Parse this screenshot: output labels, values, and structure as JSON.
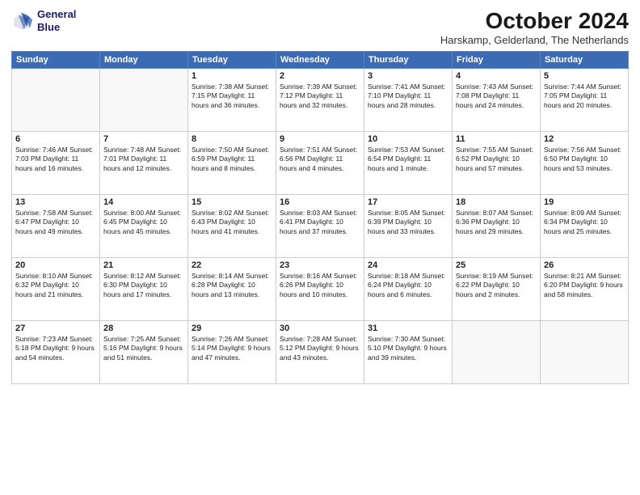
{
  "logo": {
    "line1": "General",
    "line2": "Blue"
  },
  "title": "October 2024",
  "subtitle": "Harskamp, Gelderland, The Netherlands",
  "days": [
    "Sunday",
    "Monday",
    "Tuesday",
    "Wednesday",
    "Thursday",
    "Friday",
    "Saturday"
  ],
  "weeks": [
    [
      {
        "num": "",
        "text": ""
      },
      {
        "num": "",
        "text": ""
      },
      {
        "num": "1",
        "text": "Sunrise: 7:38 AM\nSunset: 7:15 PM\nDaylight: 11 hours and 36 minutes."
      },
      {
        "num": "2",
        "text": "Sunrise: 7:39 AM\nSunset: 7:12 PM\nDaylight: 11 hours and 32 minutes."
      },
      {
        "num": "3",
        "text": "Sunrise: 7:41 AM\nSunset: 7:10 PM\nDaylight: 11 hours and 28 minutes."
      },
      {
        "num": "4",
        "text": "Sunrise: 7:43 AM\nSunset: 7:08 PM\nDaylight: 11 hours and 24 minutes."
      },
      {
        "num": "5",
        "text": "Sunrise: 7:44 AM\nSunset: 7:05 PM\nDaylight: 11 hours and 20 minutes."
      }
    ],
    [
      {
        "num": "6",
        "text": "Sunrise: 7:46 AM\nSunset: 7:03 PM\nDaylight: 11 hours and 16 minutes."
      },
      {
        "num": "7",
        "text": "Sunrise: 7:48 AM\nSunset: 7:01 PM\nDaylight: 11 hours and 12 minutes."
      },
      {
        "num": "8",
        "text": "Sunrise: 7:50 AM\nSunset: 6:59 PM\nDaylight: 11 hours and 8 minutes."
      },
      {
        "num": "9",
        "text": "Sunrise: 7:51 AM\nSunset: 6:56 PM\nDaylight: 11 hours and 4 minutes."
      },
      {
        "num": "10",
        "text": "Sunrise: 7:53 AM\nSunset: 6:54 PM\nDaylight: 11 hours and 1 minute."
      },
      {
        "num": "11",
        "text": "Sunrise: 7:55 AM\nSunset: 6:52 PM\nDaylight: 10 hours and 57 minutes."
      },
      {
        "num": "12",
        "text": "Sunrise: 7:56 AM\nSunset: 6:50 PM\nDaylight: 10 hours and 53 minutes."
      }
    ],
    [
      {
        "num": "13",
        "text": "Sunrise: 7:58 AM\nSunset: 6:47 PM\nDaylight: 10 hours and 49 minutes."
      },
      {
        "num": "14",
        "text": "Sunrise: 8:00 AM\nSunset: 6:45 PM\nDaylight: 10 hours and 45 minutes."
      },
      {
        "num": "15",
        "text": "Sunrise: 8:02 AM\nSunset: 6:43 PM\nDaylight: 10 hours and 41 minutes."
      },
      {
        "num": "16",
        "text": "Sunrise: 8:03 AM\nSunset: 6:41 PM\nDaylight: 10 hours and 37 minutes."
      },
      {
        "num": "17",
        "text": "Sunrise: 8:05 AM\nSunset: 6:39 PM\nDaylight: 10 hours and 33 minutes."
      },
      {
        "num": "18",
        "text": "Sunrise: 8:07 AM\nSunset: 6:36 PM\nDaylight: 10 hours and 29 minutes."
      },
      {
        "num": "19",
        "text": "Sunrise: 8:09 AM\nSunset: 6:34 PM\nDaylight: 10 hours and 25 minutes."
      }
    ],
    [
      {
        "num": "20",
        "text": "Sunrise: 8:10 AM\nSunset: 6:32 PM\nDaylight: 10 hours and 21 minutes."
      },
      {
        "num": "21",
        "text": "Sunrise: 8:12 AM\nSunset: 6:30 PM\nDaylight: 10 hours and 17 minutes."
      },
      {
        "num": "22",
        "text": "Sunrise: 8:14 AM\nSunset: 6:28 PM\nDaylight: 10 hours and 13 minutes."
      },
      {
        "num": "23",
        "text": "Sunrise: 8:16 AM\nSunset: 6:26 PM\nDaylight: 10 hours and 10 minutes."
      },
      {
        "num": "24",
        "text": "Sunrise: 8:18 AM\nSunset: 6:24 PM\nDaylight: 10 hours and 6 minutes."
      },
      {
        "num": "25",
        "text": "Sunrise: 8:19 AM\nSunset: 6:22 PM\nDaylight: 10 hours and 2 minutes."
      },
      {
        "num": "26",
        "text": "Sunrise: 8:21 AM\nSunset: 6:20 PM\nDaylight: 9 hours and 58 minutes."
      }
    ],
    [
      {
        "num": "27",
        "text": "Sunrise: 7:23 AM\nSunset: 5:18 PM\nDaylight: 9 hours and 54 minutes."
      },
      {
        "num": "28",
        "text": "Sunrise: 7:25 AM\nSunset: 5:16 PM\nDaylight: 9 hours and 51 minutes."
      },
      {
        "num": "29",
        "text": "Sunrise: 7:26 AM\nSunset: 5:14 PM\nDaylight: 9 hours and 47 minutes."
      },
      {
        "num": "30",
        "text": "Sunrise: 7:28 AM\nSunset: 5:12 PM\nDaylight: 9 hours and 43 minutes."
      },
      {
        "num": "31",
        "text": "Sunrise: 7:30 AM\nSunset: 5:10 PM\nDaylight: 9 hours and 39 minutes."
      },
      {
        "num": "",
        "text": ""
      },
      {
        "num": "",
        "text": ""
      }
    ]
  ]
}
